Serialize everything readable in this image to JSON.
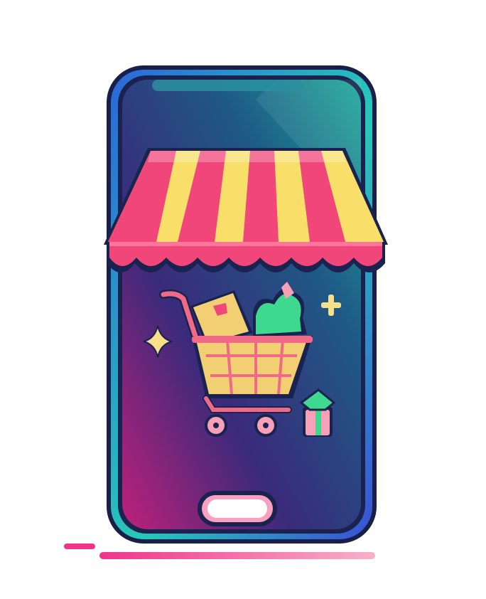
{
  "illustration": {
    "subject": "smartphone-shop-icon",
    "colors": {
      "phone_frame_top": "#2de0a8",
      "phone_frame_bottom": "#3a4fd6",
      "screen_top": "#1f7a8f",
      "screen_mid": "#233d7a",
      "screen_bottom_left": "#c0207a",
      "awning_red": "#f0467a",
      "awning_yellow": "#f7df6a",
      "cart_pink": "#f06a88",
      "basket_yellow": "#f2cf72",
      "produce_green": "#3ed88e",
      "sparkle_yellow": "#f8e08a",
      "home_button": "#ffffff",
      "underline_pink": "#f2408a"
    },
    "icons": [
      "shopping-cart-icon",
      "awning-icon",
      "sparkle-icon",
      "plus-icon",
      "gift-icon",
      "home-button-icon"
    ]
  }
}
